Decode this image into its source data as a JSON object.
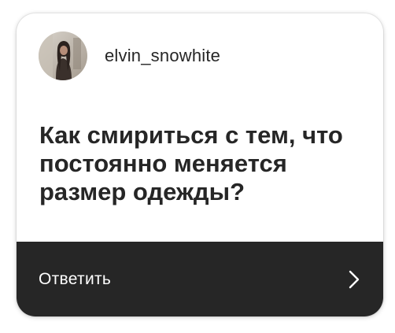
{
  "author": {
    "username": "elvin_snowhite",
    "avatar_icon": "profile-photo"
  },
  "question": {
    "text": "Как смириться с тем, что постоянно меняется размер одежды?"
  },
  "reply": {
    "label": "Ответить",
    "icon": "chevron-right-icon"
  },
  "colors": {
    "reply_bar": "#262626",
    "text": "#262626",
    "card": "#ffffff"
  }
}
